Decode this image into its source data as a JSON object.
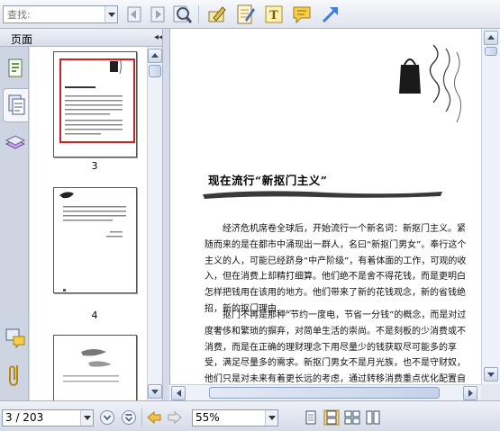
{
  "toolbar": {
    "search_placeholder": "查找:",
    "tools": [
      "prev-result-icon",
      "next-result-icon",
      "advanced-search-icon",
      "select-tool-icon",
      "note-tool-icon",
      "text-tool-icon",
      "comment-tool-icon",
      "arrow-tool-icon"
    ]
  },
  "sidebar": {
    "title": "页面",
    "collapse_glyph": "◂◂",
    "tabs": [
      "thumbnails-tab",
      "pages-tab",
      "layers-tab"
    ],
    "bottom_tabs": [
      "comments-tab",
      "attachments-tab"
    ],
    "thumbnails": [
      {
        "page": "3",
        "selected": true
      },
      {
        "page": "4",
        "selected": false
      },
      {
        "page": "",
        "selected": false
      }
    ]
  },
  "document": {
    "title": "现在流行“新抠门主义”",
    "paragraphs": [
      "经济危机席卷全球后，开始流行一个新名词：新抠门主义。紧随而来的是在都市中涌现出一群人，名曰“新抠门男女”。奉行这个主义的人，可能已经跻身“中产阶级”，有着体面的工作，可观的收入，但在消费上却精打细算。他们绝不是舍不得花钱，而是更明白怎样把钱用在该用的地方。他们带来了新的花钱观念，新的省钱绝招，新的抠门理由……",
      "抠门不再是那种“节约一度电，节省一分钱”的概念，而是对过度奢侈和繁琐的摒弃，对简单生活的崇尚。不是刻板的少消费或不消费，而是在正确的理财理念下用尽量少的钱获取尽可能多的享受，满足尽量多的需求。新抠门男女不是月光族，也不是守财奴，他们只是对未来有着更长远的考虑，通过转移消费重点优化配置自己的货币收入罢了。"
    ]
  },
  "statusbar": {
    "page_indicator": "3 / 203",
    "zoom": "55%",
    "nav_buttons": [
      "page-down-icon",
      "page-up-icon",
      "back-icon",
      "forward-icon"
    ],
    "layout_buttons": [
      "single-page-icon",
      "continuous-icon",
      "facing-icon",
      "facing-continuous-icon"
    ]
  },
  "colors": {
    "selection_border": "#d21f1f",
    "chrome_bg": "#d6dbe7",
    "accent": "#3a4d6f"
  }
}
